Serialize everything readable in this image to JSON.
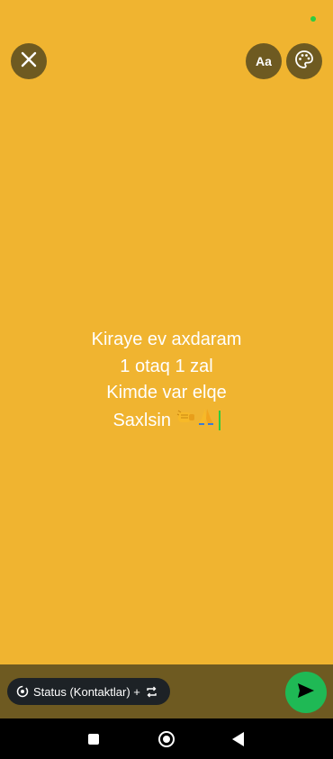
{
  "colors": {
    "background": "#f0b430",
    "overlay_button": "#6e5a21",
    "send": "#1fb955",
    "pill": "#1d2226"
  },
  "toolbar": {
    "close_icon": "close-icon",
    "font_button_label": "Aa",
    "palette_icon": "palette-icon"
  },
  "status": {
    "lines": [
      "Kiraye ev axdaram",
      "1 otaq 1 zal",
      "Kimde var elqe",
      "Saxlsin"
    ],
    "emojis": [
      "fist-emoji",
      "folded-hands-emoji"
    ]
  },
  "bottom": {
    "privacy_label": "Status (Kontaktlar) +",
    "privacy_icon": "status-icon",
    "repeat_icon": "repeat-icon",
    "send_icon": "send-icon"
  },
  "nav": {
    "recents_icon": "square-icon",
    "home_icon": "home-circle-icon",
    "back_icon": "back-triangle-icon"
  }
}
